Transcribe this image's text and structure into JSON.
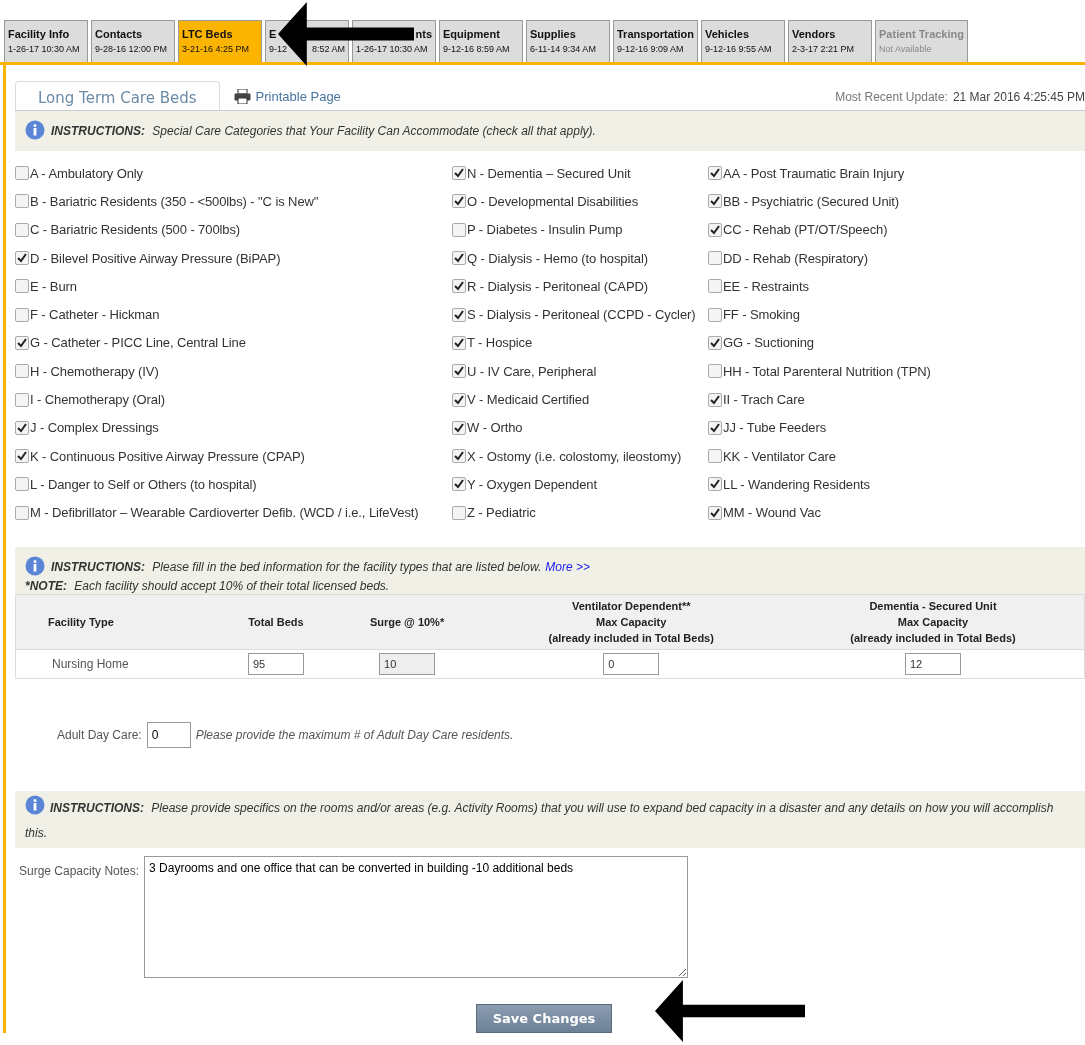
{
  "tabs": [
    {
      "label": "Facility Info",
      "date": "1-26-17 10:30 AM",
      "selected": false,
      "disabled": false
    },
    {
      "label": "Contacts",
      "date": "9-28-16 12:00 PM",
      "selected": false,
      "disabled": false
    },
    {
      "label": "LTC Beds",
      "date": "3-21-16 4:25 PM",
      "selected": true,
      "disabled": false
    },
    {
      "label": "E",
      "date": "9-12",
      "date_tail": "8:52 AM",
      "selected": false,
      "disabled": false
    },
    {
      "label_tail": "nts",
      "date": "1-26-17 10:30 AM",
      "selected": false,
      "disabled": false
    },
    {
      "label": "Equipment",
      "date": "9-12-16 8:59 AM",
      "selected": false,
      "disabled": false
    },
    {
      "label": "Supplies",
      "date": "6-11-14 9:34 AM",
      "selected": false,
      "disabled": false
    },
    {
      "label": "Transportation",
      "date": "9-12-16 9:09 AM",
      "selected": false,
      "disabled": false
    },
    {
      "label": "Vehicles",
      "date": "9-12-16 9:55 AM",
      "selected": false,
      "disabled": false
    },
    {
      "label": "Vendors",
      "date": "2-3-17 2:21 PM",
      "selected": false,
      "disabled": false
    },
    {
      "label": "Patient Tracking",
      "date": "Not Available",
      "selected": false,
      "disabled": true
    }
  ],
  "header": {
    "title": "Long Term Care Beds",
    "printable_link": "Printable Page",
    "update_label": "Most Recent Update:",
    "update_value": "21 Mar 2016 4:25:45 PM"
  },
  "categories_instructions": {
    "label": "INSTRUCTIONS:",
    "text": "Special Care Categories that Your Facility Can Accommodate (check all that apply)."
  },
  "categories": [
    [
      {
        "label": "A - Ambulatory Only",
        "checked": false
      },
      {
        "label": "B - Bariatric Residents (350 - <500lbs) - \"C is New\"",
        "checked": false
      },
      {
        "label": "C - Bariatric Residents (500 - 700lbs)",
        "checked": false
      },
      {
        "label": "D - Bilevel Positive Airway Pressure (BiPAP)",
        "checked": true
      },
      {
        "label": "E - Burn",
        "checked": false
      },
      {
        "label": "F - Catheter - Hickman",
        "checked": false
      },
      {
        "label": "G - Catheter - PICC Line, Central Line",
        "checked": true
      },
      {
        "label": "H - Chemotherapy (IV)",
        "checked": false
      },
      {
        "label": "I - Chemotherapy (Oral)",
        "checked": false
      },
      {
        "label": "J - Complex Dressings",
        "checked": true
      },
      {
        "label": "K - Continuous Positive Airway Pressure (CPAP)",
        "checked": true
      },
      {
        "label": "L - Danger to Self or Others (to hospital)",
        "checked": false
      },
      {
        "label": "M - Defibrillator – Wearable Cardioverter Defib. (WCD / i.e., LifeVest)",
        "checked": false
      }
    ],
    [
      {
        "label": "N - Dementia – Secured Unit",
        "checked": true
      },
      {
        "label": "O - Developmental Disabilities",
        "checked": true
      },
      {
        "label": "P - Diabetes - Insulin Pump",
        "checked": false
      },
      {
        "label": "Q - Dialysis - Hemo (to hospital)",
        "checked": true
      },
      {
        "label": "R - Dialysis - Peritoneal (CAPD)",
        "checked": true
      },
      {
        "label": "S - Dialysis - Peritoneal (CCPD - Cycler)",
        "checked": true
      },
      {
        "label": "T - Hospice",
        "checked": true
      },
      {
        "label": "U - IV Care, Peripheral",
        "checked": true
      },
      {
        "label": "V - Medicaid Certified",
        "checked": true
      },
      {
        "label": "W - Ortho",
        "checked": true
      },
      {
        "label": "X - Ostomy (i.e. colostomy, ileostomy)",
        "checked": true
      },
      {
        "label": "Y - Oxygen Dependent",
        "checked": true
      },
      {
        "label": "Z - Pediatric",
        "checked": false
      }
    ],
    [
      {
        "label": "AA - Post Traumatic Brain Injury",
        "checked": true
      },
      {
        "label": "BB - Psychiatric (Secured Unit)",
        "checked": true
      },
      {
        "label": "CC - Rehab (PT/OT/Speech)",
        "checked": true
      },
      {
        "label": "DD - Rehab (Respiratory)",
        "checked": false
      },
      {
        "label": "EE - Restraints",
        "checked": false
      },
      {
        "label": "FF - Smoking",
        "checked": false
      },
      {
        "label": "GG - Suctioning",
        "checked": true
      },
      {
        "label": "HH - Total Parenteral Nutrition (TPN)",
        "checked": false
      },
      {
        "label": "II - Trach Care",
        "checked": true
      },
      {
        "label": "JJ - Tube Feeders",
        "checked": true
      },
      {
        "label": "KK - Ventilator Care",
        "checked": false
      },
      {
        "label": "LL - Wandering Residents",
        "checked": true
      },
      {
        "label": "MM - Wound Vac",
        "checked": true
      }
    ]
  ],
  "beds_instructions": {
    "label": "INSTRUCTIONS:",
    "text": "Please fill in the bed information for the facility types that are listed below.",
    "link": "More >>"
  },
  "beds_note": {
    "label": "*NOTE:",
    "text": "Each facility should accept 10% of their total licensed beds."
  },
  "beds_table": {
    "columns": [
      [
        "Facility Type"
      ],
      [
        "Total Beds"
      ],
      [
        "Surge @ 10%*"
      ],
      [
        "Ventilator Dependent**",
        "Max Capacity",
        "(already included in Total Beds)"
      ],
      [
        "Dementia - Secured Unit",
        "Max Capacity",
        "(already included in Total Beds)"
      ]
    ],
    "rows": [
      {
        "facility_type": "Nursing Home",
        "total_beds": "95",
        "surge": "10",
        "ventilator": "0",
        "dementia": "12"
      }
    ]
  },
  "adult_day_care": {
    "label": "Adult Day Care:",
    "value": "0",
    "hint": "Please provide the maximum # of Adult Day Care residents."
  },
  "surge_instructions": {
    "label": "INSTRUCTIONS:",
    "text": "Please provide specifics on the rooms and/or areas (e.g. Activity Rooms) that you will use to expand bed capacity in a disaster and any details on how you will accomplish this."
  },
  "surge_notes": {
    "label": "Surge Capacity Notes:",
    "value": "3 Dayrooms and one office that can be converted in building -10 additional beds"
  },
  "save_button": "Save Changes"
}
